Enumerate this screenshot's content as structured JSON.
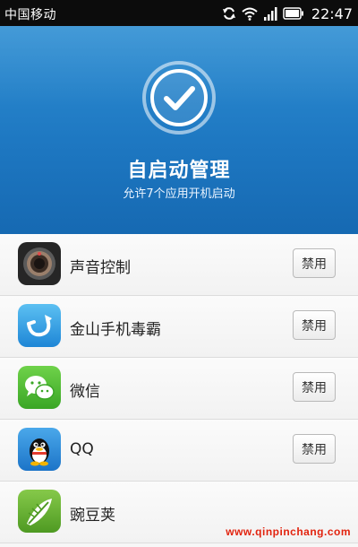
{
  "status_bar": {
    "carrier": "中国移动",
    "time": "22:47",
    "icons": [
      "sync-icon",
      "wifi-icon",
      "signal-icon",
      "battery-icon"
    ]
  },
  "header": {
    "icon": "checkmark-icon",
    "title": "自启动管理",
    "subtitle": "允许7个应用开机启动",
    "accent_color": "#1e78c2"
  },
  "apps": [
    {
      "name": "声音控制",
      "icon": "sound-control-icon",
      "button": "禁用"
    },
    {
      "name": "金山手机毒霸",
      "icon": "kingsoft-antivirus-icon",
      "button": "禁用"
    },
    {
      "name": "微信",
      "icon": "wechat-icon",
      "button": "禁用"
    },
    {
      "name": "QQ",
      "icon": "qq-icon",
      "button": "禁用"
    },
    {
      "name": "豌豆荚",
      "icon": "wandoujia-icon"
    }
  ],
  "watermark": "www.qinpinchang.com"
}
